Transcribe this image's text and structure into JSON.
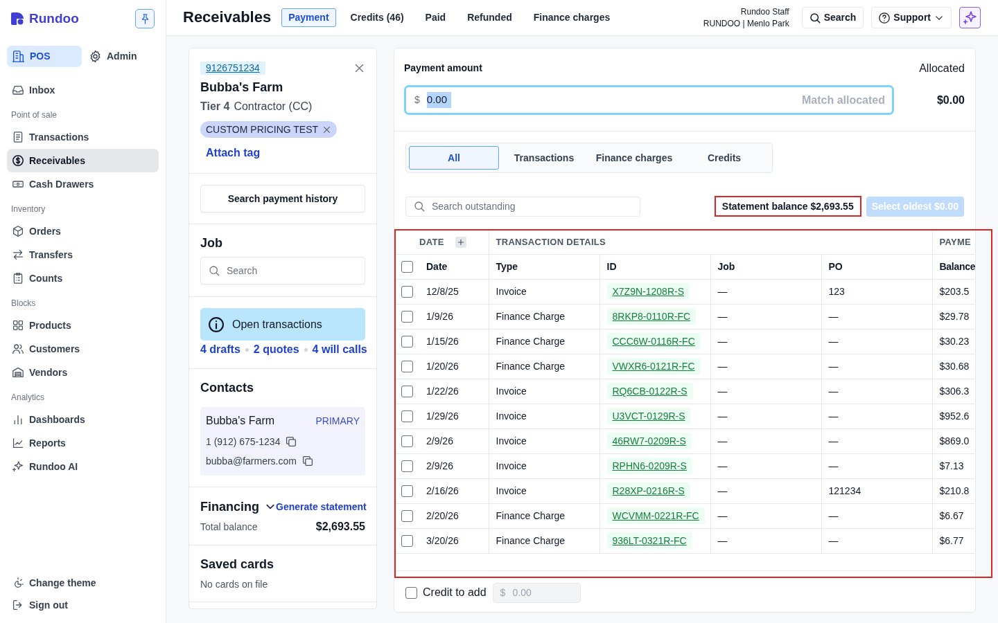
{
  "sidebar": {
    "brand": "Rundoo",
    "modes": [
      {
        "label": "POS",
        "selected": true
      },
      {
        "label": "Admin",
        "selected": false
      }
    ],
    "sections": [
      {
        "items": [
          {
            "label": "Inbox",
            "selected": false
          }
        ]
      },
      {
        "title": "Point of sale",
        "items": [
          {
            "label": "Transactions",
            "selected": false
          },
          {
            "label": "Receivables",
            "selected": true
          },
          {
            "label": "Cash Drawers",
            "selected": false
          }
        ]
      },
      {
        "title": "Inventory",
        "items": [
          {
            "label": "Orders",
            "selected": false
          },
          {
            "label": "Transfers",
            "selected": false
          },
          {
            "label": "Counts",
            "selected": false
          }
        ]
      },
      {
        "title": "Blocks",
        "items": [
          {
            "label": "Products",
            "selected": false
          },
          {
            "label": "Customers",
            "selected": false
          },
          {
            "label": "Vendors",
            "selected": false
          }
        ]
      },
      {
        "title": "Analytics",
        "items": [
          {
            "label": "Dashboards",
            "selected": false
          },
          {
            "label": "Reports",
            "selected": false
          },
          {
            "label": "Rundoo AI",
            "selected": false
          }
        ]
      }
    ],
    "footer_items": [
      {
        "label": "Change theme"
      },
      {
        "label": "Sign out"
      }
    ]
  },
  "header": {
    "title": "Receivables",
    "tabs": [
      {
        "label": "Payment",
        "selected": true
      },
      {
        "label": "Credits (46)",
        "selected": false
      },
      {
        "label": "Paid",
        "selected": false
      },
      {
        "label": "Refunded",
        "selected": false
      },
      {
        "label": "Finance charges",
        "selected": false
      }
    ],
    "user": {
      "name": "Rundoo Staff",
      "store": "RUNDOO | Menlo Park"
    },
    "search_button": "Search",
    "support_button": "Support"
  },
  "customer": {
    "phone": "9126751234",
    "name": "Bubba's Farm",
    "tier": "Tier 4",
    "type": "Contractor (CC)",
    "tags": [
      {
        "label": "CUSTOM PRICING TEST"
      }
    ],
    "attach_tag": "Attach tag"
  },
  "payment_history_button": "Search payment history",
  "job": {
    "title": "Job",
    "search_placeholder": "Search"
  },
  "open_transactions": {
    "label": "Open transactions",
    "links": [
      "4 drafts",
      "2 quotes",
      "4 will calls"
    ]
  },
  "contacts": {
    "title": "Contacts",
    "items": [
      {
        "name": "Bubba's Farm",
        "badge": "PRIMARY",
        "phone": "1 (912) 675-1234",
        "email": "bubba@farmers.com"
      }
    ]
  },
  "financing": {
    "title": "Financing",
    "action": "Generate statement",
    "total_label": "Total balance",
    "total": "$2,693.55"
  },
  "saved_cards": {
    "title": "Saved cards",
    "note": "No cards on file"
  },
  "payment": {
    "label": "Payment amount",
    "currency": "$",
    "value": "0.00",
    "focused": true,
    "value_selected": true,
    "match_button": {
      "label": "Match allocated",
      "disabled": true
    },
    "allocated_label": "Allocated",
    "allocated": "$0.00"
  },
  "filters": [
    {
      "label": "All",
      "selected": true
    },
    {
      "label": "Transactions",
      "selected": false
    },
    {
      "label": "Finance charges",
      "selected": false
    },
    {
      "label": "Credits",
      "selected": false
    }
  ],
  "outstanding_search": {
    "placeholder": "Search outstanding"
  },
  "statement_balance": {
    "text": "Statement balance $2,693.55",
    "highlighted": true
  },
  "select_oldest": {
    "label": "Select oldest $0.00",
    "disabled": true
  },
  "table": {
    "highlighted": true,
    "column_groups": [
      "DATE",
      "TRANSACTION DETAILS",
      "PAYME"
    ],
    "columns": [
      "Date",
      "Type",
      "ID",
      "Job",
      "PO",
      "Balance"
    ],
    "all_checked": false,
    "rows": [
      {
        "checked": false,
        "date": "12/8/25",
        "type": "Invoice",
        "id": "X7Z9N-1208R-S",
        "job": "—",
        "po": "123",
        "balance": "$203.5"
      },
      {
        "checked": false,
        "date": "1/9/26",
        "type": "Finance Charge",
        "id": "8RKP8-0110R-FC",
        "job": "—",
        "po": "—",
        "balance": "$29.78"
      },
      {
        "checked": false,
        "date": "1/15/26",
        "type": "Finance Charge",
        "id": "CCC6W-0116R-FC",
        "job": "—",
        "po": "—",
        "balance": "$30.23"
      },
      {
        "checked": false,
        "date": "1/20/26",
        "type": "Finance Charge",
        "id": "VWXR6-0121R-FC",
        "job": "—",
        "po": "—",
        "balance": "$30.68"
      },
      {
        "checked": false,
        "date": "1/22/26",
        "type": "Invoice",
        "id": "RQ6CB-0122R-S",
        "job": "—",
        "po": "—",
        "balance": "$306.3"
      },
      {
        "checked": false,
        "date": "1/29/26",
        "type": "Invoice",
        "id": "U3VCT-0129R-S",
        "job": "—",
        "po": "—",
        "balance": "$952.6"
      },
      {
        "checked": false,
        "date": "2/9/26",
        "type": "Invoice",
        "id": "46RW7-0209R-S",
        "job": "—",
        "po": "—",
        "balance": "$869.0"
      },
      {
        "checked": false,
        "date": "2/9/26",
        "type": "Invoice",
        "id": "RPHN6-0209R-S",
        "job": "—",
        "po": "—",
        "balance": "$7.13"
      },
      {
        "checked": false,
        "date": "2/16/26",
        "type": "Invoice",
        "id": "R28XP-0216R-S",
        "job": "—",
        "po": "121234",
        "balance": "$210.8"
      },
      {
        "checked": false,
        "date": "2/20/26",
        "type": "Finance Charge",
        "id": "WCVMM-0221R-FC",
        "job": "—",
        "po": "—",
        "balance": "$6.67"
      },
      {
        "checked": false,
        "date": "3/20/26",
        "type": "Finance Charge",
        "id": "936LT-0321R-FC",
        "job": "—",
        "po": "—",
        "balance": "$6.77"
      }
    ]
  },
  "credit": {
    "label": "Credit to add",
    "checked": false,
    "currency": "$",
    "placeholder": "0.00",
    "disabled": true
  }
}
